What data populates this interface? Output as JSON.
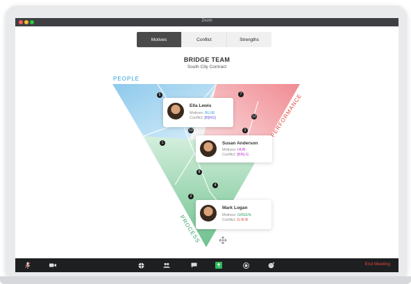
{
  "window": {
    "title": "Zoom"
  },
  "tabs": [
    {
      "label": "Motives",
      "active": true
    },
    {
      "label": "Conflict",
      "active": false
    },
    {
      "label": "Strengths",
      "active": false
    }
  ],
  "team": {
    "title": "BRIDGE TEAM",
    "subtitle": "South City Contract"
  },
  "triangle": {
    "labels": {
      "people": "PEOPLE",
      "performance": "PERFORMANCE",
      "process": "PROCESS"
    }
  },
  "cards": [
    {
      "name": "Ella Lewis",
      "motives_label": "Motives: ",
      "motives_value": "BLUE",
      "conflict_label": "Conflict: ",
      "conflict_value": "[B]RG]"
    },
    {
      "name": "Susan Anderson",
      "motives_label": "Motives: ",
      "motives_value": "HUB",
      "conflict_label": "Conflict: ",
      "conflict_value": "[BR]-G"
    },
    {
      "name": "Mark Logan",
      "motives_label": "Motives: ",
      "motives_value": "GREEN",
      "conflict_label": "Conflict: ",
      "conflict_value": "G-R-B"
    }
  ],
  "toolbar": {
    "end_label": "End Meeting"
  },
  "colors": {
    "blue": "#2e9fd6",
    "green": "#3aa56b",
    "red": "#e2443b",
    "hub": "#c03bd0"
  },
  "icons": [
    "mic-icon",
    "video-icon",
    "security-icon",
    "participants-icon",
    "chat-icon",
    "share-screen-icon",
    "record-icon",
    "reactions-icon",
    "move-icon"
  ]
}
